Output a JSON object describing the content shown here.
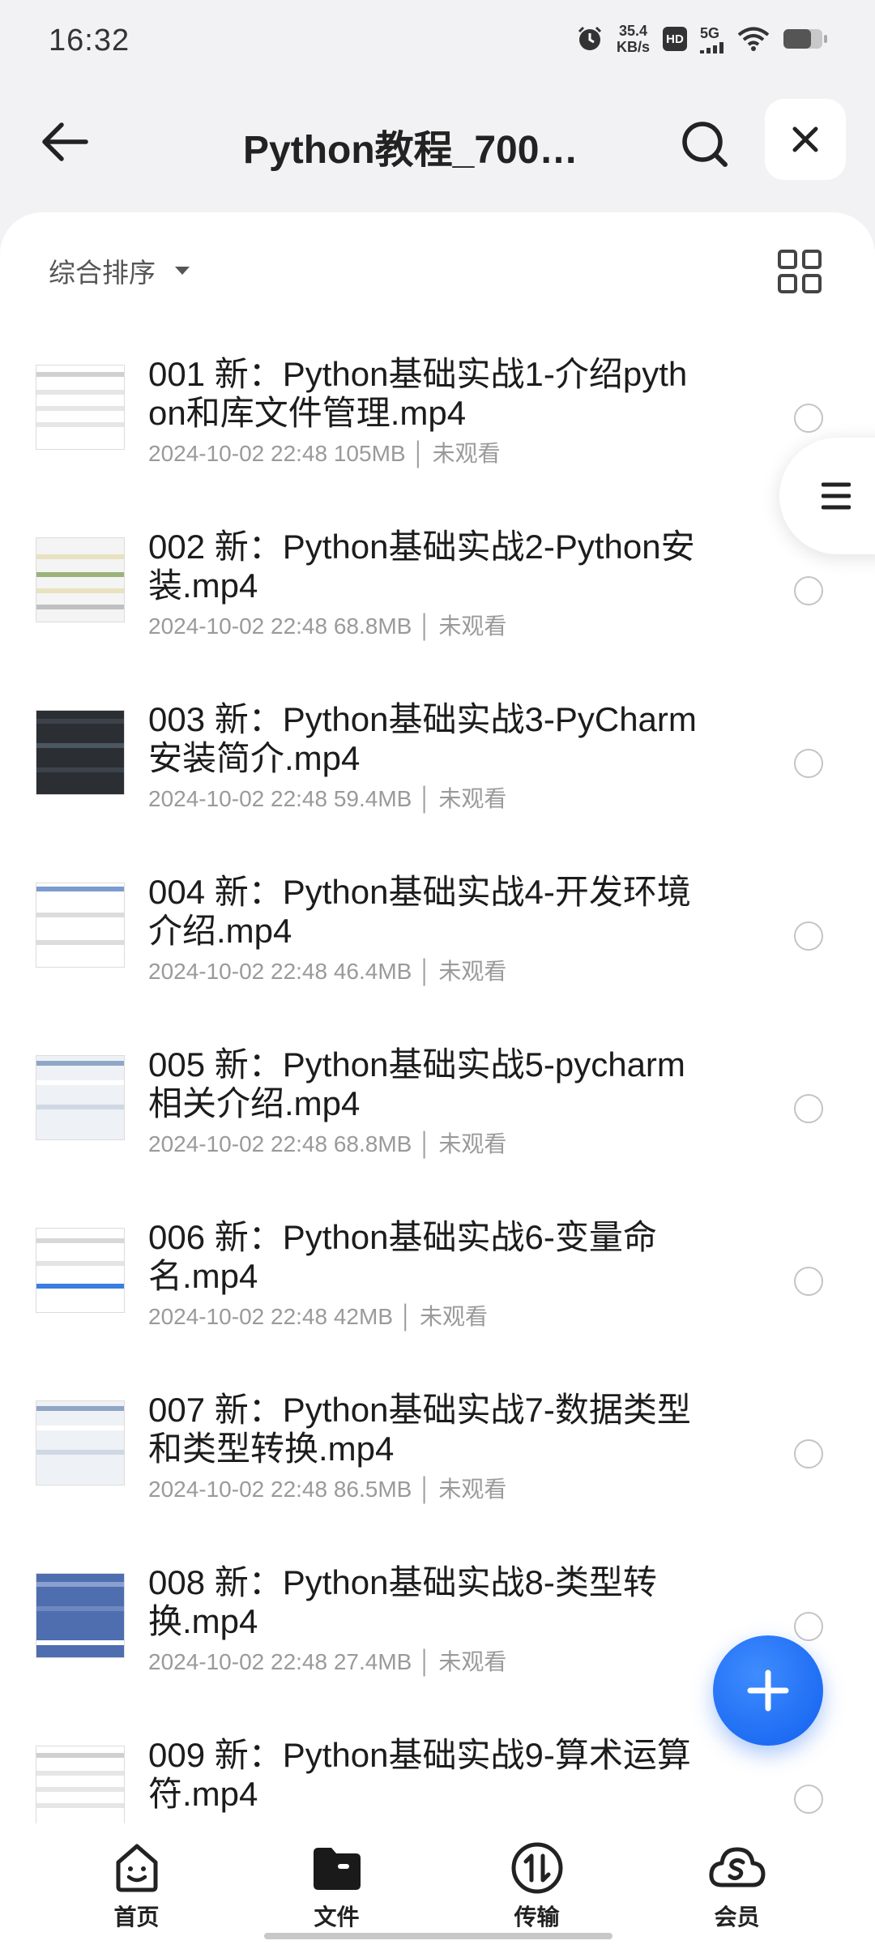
{
  "status_bar": {
    "time": "16:32",
    "net_speed_value": "35.4",
    "net_speed_unit": "KB/s",
    "hd_label": "HD",
    "signal_label": "5G",
    "icons": [
      "alarm-icon",
      "hd-icon",
      "signal-5g-icon",
      "wifi-icon",
      "battery-icon"
    ]
  },
  "top_bar": {
    "title": "Python教程_700…",
    "icons": [
      "back-arrow-icon",
      "search-icon",
      "close-icon"
    ]
  },
  "sort": {
    "label": "综合排序",
    "icons": [
      "caret-down-icon",
      "grid-view-icon"
    ]
  },
  "files": [
    {
      "name": "001 新：Python基础实战1-介绍python和库文件管理.mp4",
      "meta": "2024-10-02 22:48  105MB │ 未观看",
      "thumb": "light"
    },
    {
      "name": "002 新：Python基础实战2-Python安装.mp4",
      "meta": "2024-10-02 22:48  68.8MB │ 未观看",
      "thumb": "doc"
    },
    {
      "name": "003 新：Python基础实战3-PyCharm安装简介.mp4",
      "meta": "2024-10-02 22:48  59.4MB │ 未观看",
      "thumb": "dark"
    },
    {
      "name": "004 新：Python基础实战4-开发环境介绍.mp4",
      "meta": "2024-10-02 22:48  46.4MB │ 未观看",
      "thumb": "diagram"
    },
    {
      "name": "005 新：Python基础实战5-pycharm相关介绍.mp4",
      "meta": "2024-10-02 22:48  68.8MB │ 未观看",
      "thumb": "window"
    },
    {
      "name": "006 新：Python基础实战6-变量命名.mp4",
      "meta": "2024-10-02 22:48  42MB │ 未观看",
      "thumb": "blue"
    },
    {
      "name": "007 新：Python基础实战7-数据类型和类型转换.mp4",
      "meta": "2024-10-02 22:48  86.5MB │ 未观看",
      "thumb": "window"
    },
    {
      "name": "008 新：Python基础实战8-类型转换.mp4",
      "meta": "2024-10-02 22:48  27.4MB │ 未观看",
      "thumb": "bluefill"
    },
    {
      "name": "009 新：Python基础实战9-算术运算符.mp4",
      "meta": "",
      "thumb": "light"
    }
  ],
  "side_handle": {
    "icon": "menu-lines-icon"
  },
  "fab": {
    "icon": "plus-icon"
  },
  "bottom_nav": [
    {
      "label": "首页",
      "icon": "home-face-icon"
    },
    {
      "label": "文件",
      "icon": "folder-icon"
    },
    {
      "label": "传输",
      "icon": "transfer-icon"
    },
    {
      "label": "会员",
      "icon": "vip-cloud-icon"
    }
  ],
  "colors": {
    "accent": "#1160ee",
    "text_primary": "#1c1c1c",
    "text_secondary": "#9a9a9a",
    "background": "#f2f2f4"
  }
}
